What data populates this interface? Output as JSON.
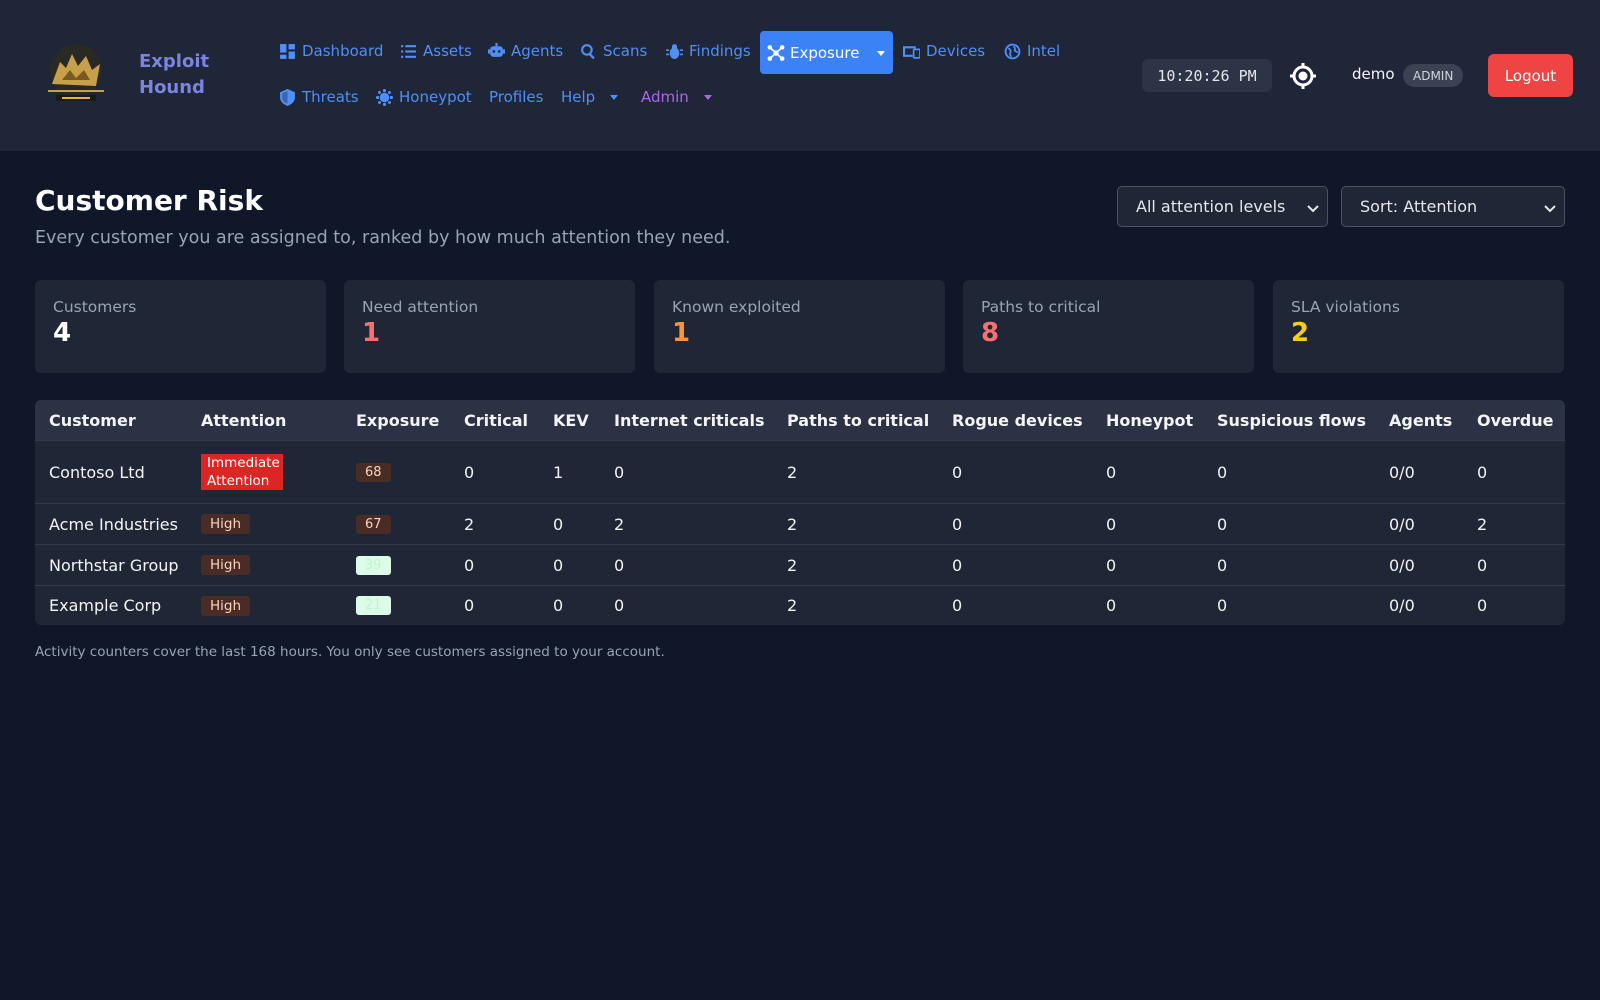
{
  "brand": {
    "line1": "Exploit",
    "line2": "Hound"
  },
  "nav": {
    "dashboard": "Dashboard",
    "assets": "Assets",
    "agents": "Agents",
    "scans": "Scans",
    "findings": "Findings",
    "exposure": "Exposure",
    "devices": "Devices",
    "intel": "Intel",
    "threats": "Threats",
    "honeypot": "Honeypot",
    "profiles": "Profiles",
    "help": "Help",
    "admin": "Admin"
  },
  "header": {
    "clock": "10:20:26 PM",
    "user": "demo",
    "role": "ADMIN",
    "logout": "Logout"
  },
  "page": {
    "title": "Customer Risk",
    "subtitle": "Every customer you are assigned to, ranked by how much attention they need.",
    "filter_select": "All attention levels",
    "sort_select": "Sort: Attention"
  },
  "stats": [
    {
      "label": "Customers",
      "value": "4",
      "color": "#ffffff"
    },
    {
      "label": "Need attention",
      "value": "1",
      "color": "#f87171"
    },
    {
      "label": "Known exploited",
      "value": "1",
      "color": "#fb923c"
    },
    {
      "label": "Paths to critical",
      "value": "8",
      "color": "#f87171"
    },
    {
      "label": "SLA violations",
      "value": "2",
      "color": "#facc15"
    }
  ],
  "table": {
    "headers": [
      "Customer",
      "Attention",
      "Exposure",
      "Critical",
      "KEV",
      "Internet criticals",
      "Paths to critical",
      "Rogue devices",
      "Honeypot",
      "Suspicious flows",
      "Agents",
      "Overdue"
    ],
    "rows": [
      {
        "customer": "Contoso Ltd",
        "attention_1": "Immediate",
        "attention_2": "Attention",
        "exposure": "68",
        "critical": "0",
        "kev": "1",
        "internet": "0",
        "paths": "2",
        "rogue": "0",
        "honeypot": "0",
        "flows": "0",
        "agents": "0/0",
        "overdue": "0"
      },
      {
        "customer": "Acme Industries",
        "attention": "High",
        "exposure": "67",
        "critical": "2",
        "kev": "0",
        "internet": "2",
        "paths": "2",
        "rogue": "0",
        "honeypot": "0",
        "flows": "0",
        "agents": "0/0",
        "overdue": "2"
      },
      {
        "customer": "Northstar Group",
        "attention": "High",
        "exposure": "39",
        "critical": "0",
        "kev": "0",
        "internet": "0",
        "paths": "2",
        "rogue": "0",
        "honeypot": "0",
        "flows": "0",
        "agents": "0/0",
        "overdue": "0"
      },
      {
        "customer": "Example Corp",
        "attention": "High",
        "exposure": "21",
        "critical": "0",
        "kev": "0",
        "internet": "0",
        "paths": "2",
        "rogue": "0",
        "honeypot": "0",
        "flows": "0",
        "agents": "0/0",
        "overdue": "0"
      }
    ]
  },
  "footnote": "Activity counters cover the last 168 hours. You only see customers assigned to your account.",
  "colors": {
    "accent": "#3b82f6",
    "logout": "#ef4444",
    "immediate": "#dc2626"
  }
}
